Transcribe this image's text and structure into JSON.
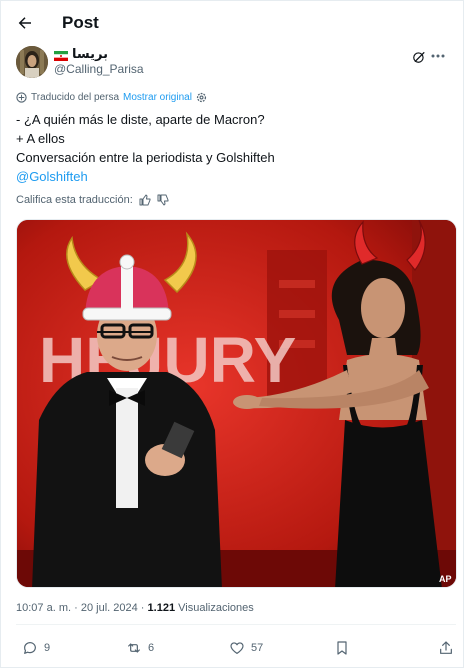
{
  "header": {
    "title": "Post"
  },
  "author": {
    "display_name": "بريسا",
    "handle": "@Calling_Parisa"
  },
  "translation": {
    "label": "Traducido del persa",
    "show_original": "Mostrar original"
  },
  "tweet": {
    "lines": [
      "- ¿A quién más le diste, aparte de Macron?",
      "+ A ellos",
      "Conversación entre la periodista y Golshifteh"
    ],
    "mention": "@Golshifteh"
  },
  "rate": {
    "label": "Califica esta traducción:"
  },
  "media": {
    "banner_text": "HEJURY",
    "credit": "AP"
  },
  "meta": {
    "time": "10:07 a. m.",
    "separator": "·",
    "date": "20 jul. 2024",
    "views_count": "1.121",
    "views_label": "Visualizaciones"
  },
  "actions": {
    "replies": "9",
    "reposts": "6",
    "likes": "57"
  },
  "colors": {
    "accent": "#1d9bf0",
    "muted": "#536471",
    "text": "#0f1419"
  }
}
